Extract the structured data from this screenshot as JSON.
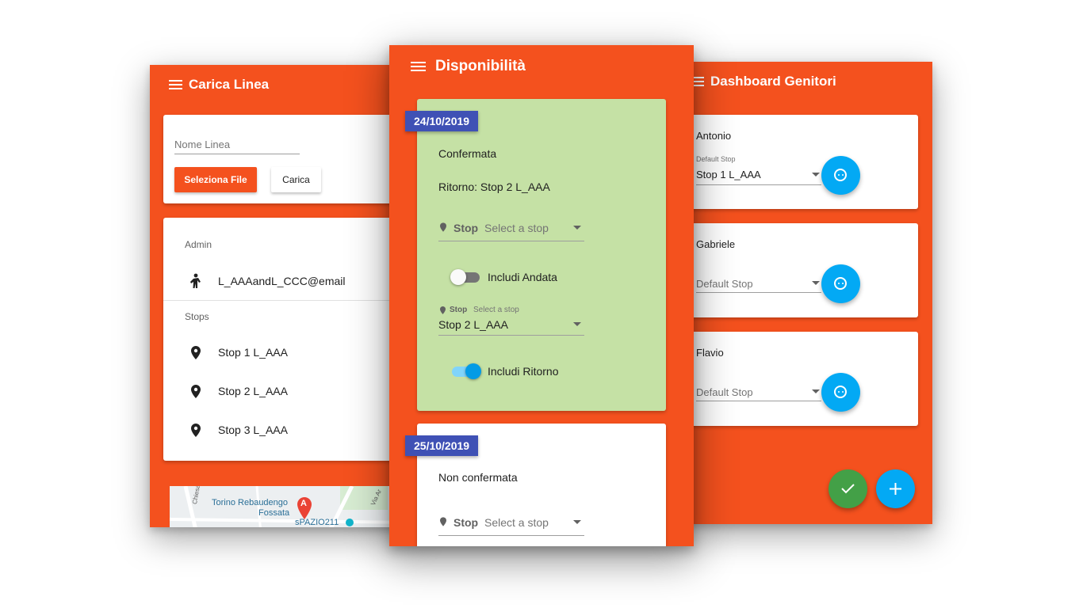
{
  "left_screen": {
    "title": "Carica Linea",
    "nome_linea_placeholder": "Nome Linea",
    "select_file_label": "Seleziona File",
    "upload_label": "Carica",
    "admin_header": "Admin",
    "admin_email": "L_AAAandL_CCC@email",
    "stops_header": "Stops",
    "stops": [
      "Stop 1 L_AAA",
      "Stop 2 L_AAA",
      "Stop 3 L_AAA"
    ],
    "map": {
      "street_1": "Torino Rebaudengo",
      "street_2": "Fossata",
      "street_3": "sPAZIO211",
      "street_4": "Via Ar",
      "street_5": "Chiesa della S",
      "marker": "A"
    }
  },
  "middle_screen": {
    "title": "Disponibilità",
    "cards": [
      {
        "date": "24/10/2019",
        "status": "Confermata",
        "ritorno_text": "Ritorno: Stop 2 L_AAA",
        "stop_label": "Stop",
        "stop_placeholder": "Select a stop",
        "andata_toggle_label": "Includi Andata",
        "andata_on": false,
        "ritorno_field_label": "Stop",
        "ritorno_field_placeholder": "Select a stop",
        "ritorno_field_value": "Stop 2 L_AAA",
        "ritorno_toggle_label": "Includi Ritorno",
        "ritorno_on": true
      },
      {
        "date": "25/10/2019",
        "status": "Non confermata",
        "stop_label": "Stop",
        "stop_placeholder": "Select a stop"
      }
    ]
  },
  "right_screen": {
    "title": "Dashboard Genitori",
    "children": [
      {
        "name": "Antonio",
        "stop_label": "Default Stop",
        "stop_value": "Stop 1 L_AAA"
      },
      {
        "name": "Gabriele",
        "stop_placeholder": "Default Stop"
      },
      {
        "name": "Flavio",
        "stop_placeholder": "Default Stop"
      }
    ],
    "confirm_icon": "check-icon",
    "add_icon": "plus-icon"
  },
  "colors": {
    "primary": "#f4511e",
    "indigo_badge": "#3f51b5",
    "confirmed_card": "#c5e1a5",
    "fab_blue": "#03a9f4",
    "fab_green": "#43a047",
    "toggle_on": "#039be5"
  }
}
